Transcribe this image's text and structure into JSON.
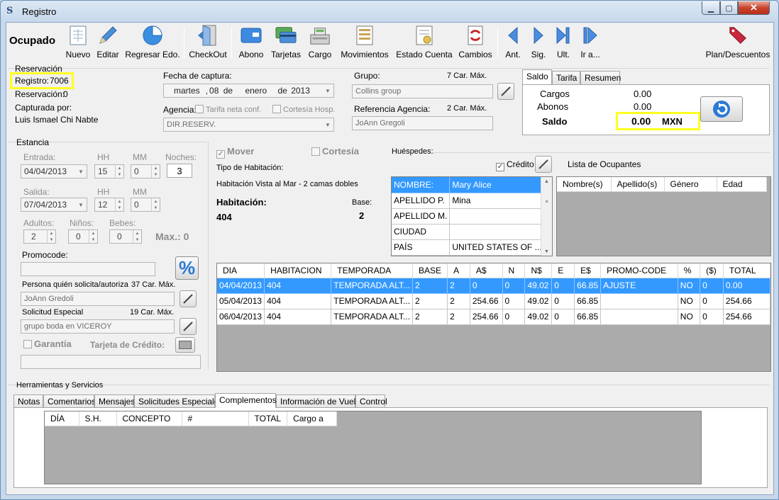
{
  "window": {
    "title": "Registro",
    "icon": "S"
  },
  "toolbar": {
    "status": "Ocupado",
    "buttons": [
      {
        "label": "Nuevo",
        "icon": "new-document-icon"
      },
      {
        "label": "Editar",
        "icon": "pencil-icon"
      },
      {
        "label": "Regresar Edo.",
        "icon": "pie-chart-icon"
      },
      {
        "label": "CheckOut",
        "icon": "door-exit-icon"
      },
      {
        "label": "Abono",
        "icon": "card-icon"
      },
      {
        "label": "Tarjetas",
        "icon": "credit-cards-icon"
      },
      {
        "label": "Cargo",
        "icon": "cash-register-icon"
      },
      {
        "label": "Movimientos",
        "icon": "ledger-icon"
      },
      {
        "label": "Estado Cuenta",
        "icon": "statement-icon"
      },
      {
        "label": "Cambios",
        "icon": "exchange-icon"
      },
      {
        "label": "Ant.",
        "icon": "previous-icon"
      },
      {
        "label": "Sig.",
        "icon": "next-icon"
      },
      {
        "label": "Ult.",
        "icon": "last-icon"
      },
      {
        "label": "Ir a...",
        "icon": "goto-icon"
      }
    ],
    "plan_label": "Plan/Descuentos"
  },
  "reservacion": {
    "title": "Reservación",
    "registro_label": "Registro:",
    "registro_value": "7006",
    "reservacion_label": "Reservación:",
    "reservacion_value": "0",
    "capturada_label": "Capturada por:",
    "capturada_value": "Luis Ismael Chi Nabte",
    "fecha_label": "Fecha de captura:",
    "fecha": {
      "dow": "martes",
      "sep": ",",
      "day": "08",
      "de1": "de",
      "month": "enero",
      "de2": "de",
      "year": "2013"
    },
    "agencia_label": "Agencia:",
    "tarifa_neta": "Tarifa neta conf.",
    "cortesia_hosp": "Cortesía Hosp.",
    "agencia_value": "DIR.RESERV.",
    "grupo_label": "Grupo:",
    "grupo_max": "7 Car. Máx.",
    "grupo_value": "Collins group",
    "ref_label": "Referencia Agencia:",
    "ref_max": "2 Car. Máx.",
    "ref_value": "JoAnn Gregoli"
  },
  "saldo": {
    "tabs": [
      "Saldo",
      "Tarifa",
      "Resumen"
    ],
    "cargos_label": "Cargos",
    "cargos_value": "0.00",
    "abonos_label": "Abonos",
    "abonos_value": "0.00",
    "saldo_label": "Saldo",
    "saldo_value": "0.00",
    "currency": "MXN"
  },
  "estancia": {
    "title": "Estancia",
    "entrada_label": "Entrada:",
    "entrada_value": "04/04/2013",
    "hh_label": "HH",
    "mm_label": "MM",
    "noches_label": "Noches:",
    "entrada_hh": "15",
    "entrada_mm": "0",
    "noches_value": "3",
    "salida_label": "Salida:",
    "salida_value": "07/04/2013",
    "salida_hh": "12",
    "salida_mm": "0",
    "adultos_label": "Adultos:",
    "ninos_label": "Niños:",
    "bebes_label": "Bebes:",
    "adultos_value": "2",
    "ninos_value": "0",
    "bebes_value": "0",
    "max_label": "Max.: 0",
    "promocode_label": "Promocode:",
    "persona_label": "Persona quién solicita/autoriza",
    "persona_max": "37 Car. Máx.",
    "persona_value": "JoAnn Gredoli",
    "solicitud_label": "Solicitud Especial",
    "solicitud_max": "19 Car. Máx.",
    "solicitud_value": "grupo boda en VICEROY",
    "garantia_label": "Garantía",
    "tarjeta_label": "Tarjeta de Crédito:"
  },
  "habitacion": {
    "mover_label": "Mover",
    "cortesia_label": "Cortesía",
    "tipo_label": "Tipo de Habitación:",
    "tipo_value": "Habitación Vista al Mar - 2 camas dobles",
    "hab_label": "Habitación:",
    "hab_value": "404",
    "base_label": "Base:",
    "base_value": "2"
  },
  "huespedes": {
    "title": "Huéspedes:",
    "credito_label": "Crédito",
    "lista_label": "Lista de Ocupantes",
    "fields": [
      {
        "name": "NOMBRE:",
        "value": "Mary Alice"
      },
      {
        "name": "APELLIDO P.",
        "value": "Mina"
      },
      {
        "name": "APELLIDO M.",
        "value": ""
      },
      {
        "name": "CIUDAD",
        "value": ""
      },
      {
        "name": "PAÍS",
        "value": "UNITED STATES OF ..."
      }
    ],
    "ocupantes_headers": [
      "Nombre(s)",
      "Apellido(s)",
      "Género",
      "Edad"
    ]
  },
  "tarifas": {
    "headers": [
      "DIA",
      "HABITACION",
      "TEMPORADA",
      "BASE",
      "A",
      "A$",
      "N",
      "N$",
      "E",
      "E$",
      "PROMO-CODE",
      "%",
      "($)",
      "TOTAL"
    ],
    "rows": [
      [
        "04/04/2013",
        "404",
        "TEMPORADA ALT...",
        "2",
        "2",
        "0",
        "0",
        "49.02",
        "0",
        "66.85",
        "AJUSTE",
        "NO",
        "0",
        "0.00"
      ],
      [
        "05/04/2013",
        "404",
        "TEMPORADA ALT...",
        "2",
        "2",
        "254.66",
        "0",
        "49.02",
        "0",
        "66.85",
        "",
        "NO",
        "0",
        "254.66"
      ],
      [
        "06/04/2013",
        "404",
        "TEMPORADA ALT...",
        "2",
        "2",
        "254.66",
        "0",
        "49.02",
        "0",
        "66.85",
        "",
        "NO",
        "0",
        "254.66"
      ]
    ]
  },
  "herramientas": {
    "title": "Herramientas y Servicios",
    "tabs": [
      "Notas",
      "Comentarios",
      "Mensajes",
      "Solicitudes Especiales",
      "Complementos",
      "Información de Vuelos",
      "Control"
    ],
    "active_tab": 4,
    "headers": [
      "DÍA",
      "S.H.",
      "CONCEPTO",
      "#",
      "TOTAL",
      "Cargo a"
    ]
  }
}
